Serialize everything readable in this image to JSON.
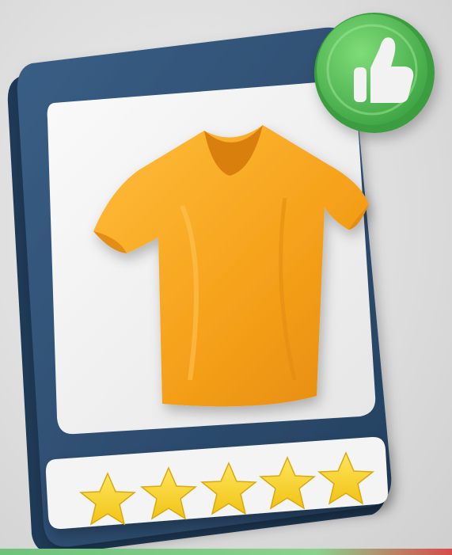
{
  "scene": {
    "subject": "product-review-phone",
    "product": "t-shirt",
    "rating": {
      "value": 5,
      "max": 5
    },
    "badge_icon": "thumbs-up-icon",
    "colors": {
      "background": "#dedede",
      "phone_frame": "#2f4f72",
      "screen": "#f2f2f2",
      "shirt": "#f7a21b",
      "star": "#f6d32a",
      "badge": "#55b955"
    }
  }
}
